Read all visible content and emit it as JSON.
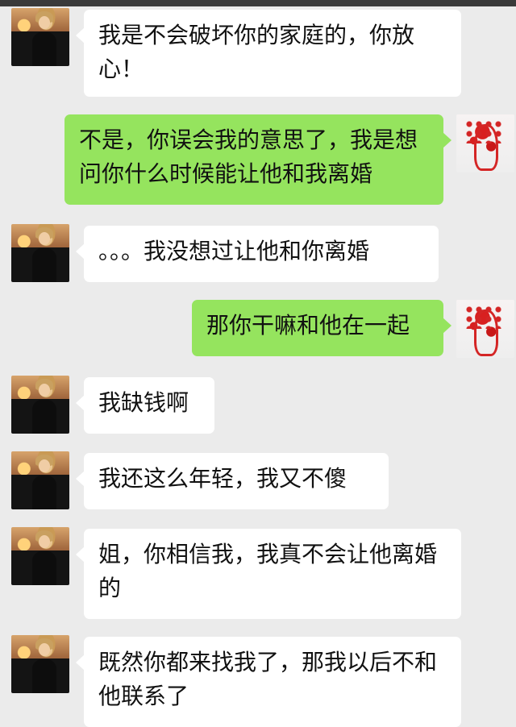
{
  "messages": [
    {
      "side": "in",
      "text": "我是不会破坏你的家庭的，你放心！"
    },
    {
      "side": "out",
      "text": "不是，你误会我的意思了，我是想问你什么时候能让他和我离婚"
    },
    {
      "side": "in",
      "text": "。。。我没想过让他和你离婚"
    },
    {
      "side": "out",
      "text": "那你干嘛和他在一起"
    },
    {
      "side": "in",
      "text": "我缺钱啊"
    },
    {
      "side": "in",
      "text": "我还这么年轻，我又不傻"
    },
    {
      "side": "in",
      "text": "姐，你相信我，我真不会让他离婚的"
    },
    {
      "side": "in",
      "text": "既然你都来找我了，那我以后不和他联系了"
    }
  ],
  "colors": {
    "background": "#ebebeb",
    "incoming_bubble": "#ffffff",
    "outgoing_bubble": "#95e45e"
  }
}
